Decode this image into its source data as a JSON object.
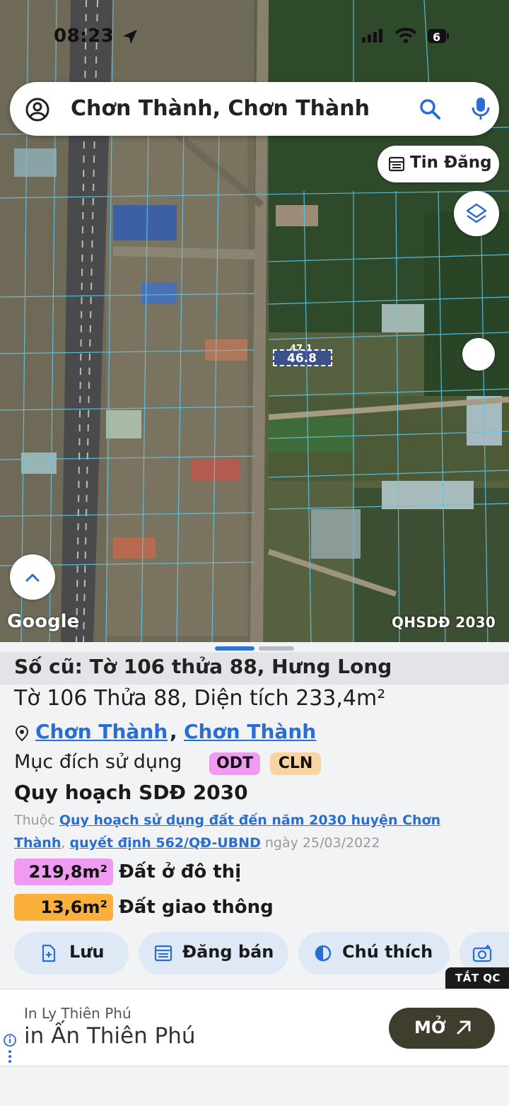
{
  "status_bar": {
    "time": "08:23",
    "battery": "6"
  },
  "search": {
    "query": "Chơn Thành, Chơn Thành"
  },
  "map": {
    "tin_dang_label": "Tin Đăng",
    "parcel_label": "46.8",
    "parcel_label_top": "47.1",
    "google_logo": "Google",
    "layer_badge": "QHSDĐ 2030"
  },
  "sheet": {
    "old_id": "Số cũ: Tờ 106 thửa 88, Hưng Long",
    "parcel_title": "Tờ 106 Thửa 88, Diện tích 233,4m²",
    "location": {
      "district": "Chơn Thành",
      "ward": "Chơn Thành",
      "separator": ","
    },
    "purpose_label": "Mục đích sử dụng",
    "purpose_tags": [
      {
        "code": "ODT",
        "color": "#f19af1"
      },
      {
        "code": "CLN",
        "color": "#f9d4a2"
      }
    ],
    "plan_heading": "Quy hoạch SDĐ 2030",
    "plan_source": {
      "prefix": "Thuộc",
      "plan_link": "Quy hoạch sử dụng đất đến năm 2030 huyện Chơn Thành",
      "separator": ",",
      "decision_link": "quyết định 562/QĐ-UBND",
      "date_text": "ngày 25/03/2022"
    },
    "areas": [
      {
        "value": "219,8m²",
        "label": "Đất ở đô thị",
        "color": "#f19af1"
      },
      {
        "value": "13,6m²",
        "label": "Đất giao thông",
        "color": "#fbb03b"
      }
    ],
    "actions": [
      {
        "label": "Lưu",
        "icon": "add-file-icon"
      },
      {
        "label": "Đăng bán",
        "icon": "listing-icon"
      },
      {
        "label": "Chú thích",
        "icon": "contrast-icon"
      },
      {
        "label": "",
        "icon": "camera-add-icon"
      }
    ]
  },
  "ad": {
    "close_label": "TẮT QC",
    "subtitle": "In Ly Thiên Phú",
    "title": "in Ấn Thiên Phú",
    "open_label": "MỞ"
  }
}
